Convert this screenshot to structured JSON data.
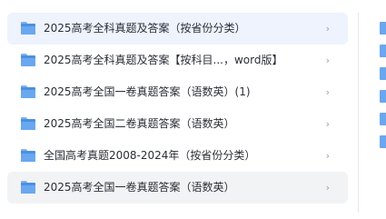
{
  "folders": [
    {
      "name": "2025高考全科真题及答案（按省份分类）",
      "icon": "folder-icon",
      "chevron": "›",
      "highlight": "blue"
    },
    {
      "name": "2025高考全科真题及答案【按科目...，word版】",
      "icon": "folder-icon",
      "chevron": "›",
      "highlight": ""
    },
    {
      "name": "2025高考全国一卷真题答案（语数英）(1)",
      "icon": "folder-icon",
      "chevron": "›",
      "highlight": ""
    },
    {
      "name": "2025高考全国二卷真题答案（语数英）",
      "icon": "folder-icon",
      "chevron": "›",
      "highlight": ""
    },
    {
      "name": "全国高考真题2008-2024年（按省份分类）",
      "icon": "folder-icon",
      "chevron": "›",
      "highlight": ""
    },
    {
      "name": "2025高考全国一卷真题答案（语数英）",
      "icon": "folder-icon",
      "chevron": "›",
      "highlight": "gray"
    }
  ],
  "colors": {
    "folder": "#4a90e2",
    "highlight_blue": "#eef3fd",
    "highlight_gray": "#f2f3f5",
    "text": "#2b2f36",
    "chevron": "#9aa0a8"
  }
}
